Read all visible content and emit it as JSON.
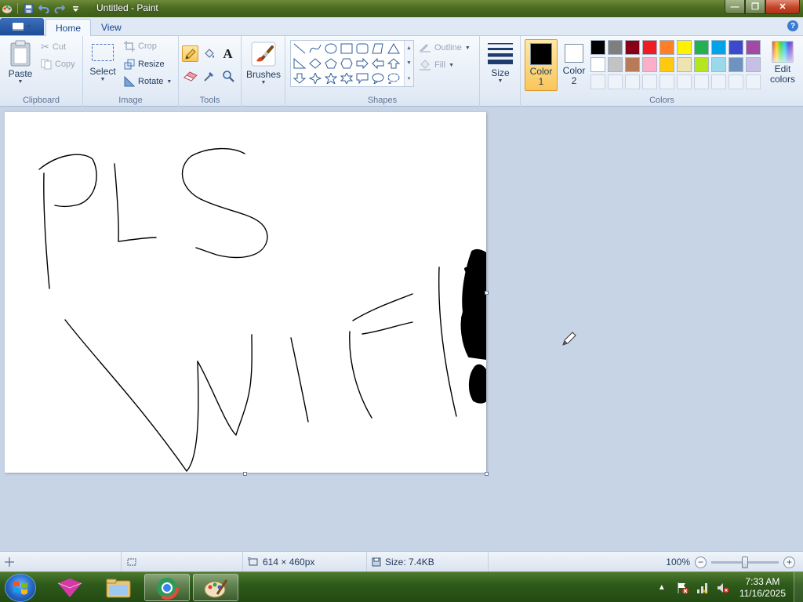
{
  "window": {
    "title": "Untitled - Paint",
    "controls": {
      "minimize": "—",
      "maximize": "❐",
      "close": "✕"
    }
  },
  "ribbon_tabs": {
    "home": "Home",
    "view": "View"
  },
  "clipboard": {
    "paste": "Paste",
    "cut": "Cut",
    "copy": "Copy",
    "group_label": "Clipboard"
  },
  "image": {
    "select": "Select",
    "crop": "Crop",
    "resize": "Resize",
    "rotate": "Rotate",
    "group_label": "Image"
  },
  "tools": {
    "group_label": "Tools",
    "text_glyph": "A",
    "active_tool": "pencil"
  },
  "brushes": {
    "label": "Brushes"
  },
  "shapes": {
    "outline": "Outline",
    "fill": "Fill",
    "group_label": "Shapes"
  },
  "size": {
    "label": "Size"
  },
  "colors": {
    "color1_line1": "Color",
    "color1_line2": "1",
    "color2_line1": "Color",
    "color2_line2": "2",
    "color1_value": "#000000",
    "color2_value": "#ffffff",
    "edit_line1": "Edit",
    "edit_line2": "colors",
    "group_label": "Colors",
    "palette_row1": [
      "#000000",
      "#7f7f7f",
      "#880015",
      "#ed1c24",
      "#ff7f27",
      "#fff200",
      "#22b14c",
      "#00a2e8",
      "#3f48cc",
      "#a349a4"
    ],
    "palette_row2": [
      "#ffffff",
      "#c3c3c3",
      "#b97a57",
      "#ffaec9",
      "#ffc90e",
      "#efe4b0",
      "#b5e61d",
      "#99d9ea",
      "#7092be",
      "#c8bfe7"
    ]
  },
  "statusbar": {
    "dimensions": "614 × 460px",
    "size": "Size: 7.4KB",
    "zoom": "100%",
    "zoom_minus": "−",
    "zoom_plus": "+"
  },
  "taskbar": {
    "time": "7:33 AM",
    "date": "11/16/2025"
  }
}
